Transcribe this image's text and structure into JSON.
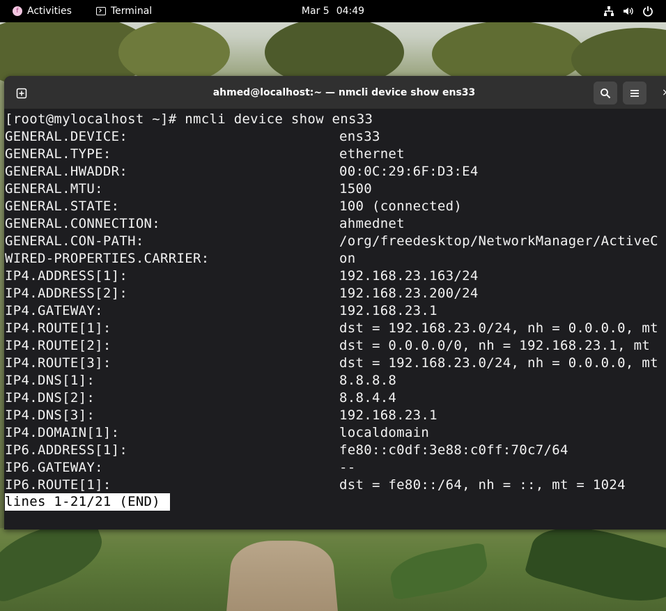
{
  "topbar": {
    "activities_label": "Activities",
    "app_label": "Terminal",
    "date": "Mar 5",
    "time": "04:49",
    "icons": [
      "network-icon",
      "volume-icon",
      "power-icon"
    ]
  },
  "window": {
    "title": "ahmed@localhost:~ — nmcli device show ens33",
    "buttons": [
      "new-tab-icon",
      "search-icon",
      "menu-icon"
    ]
  },
  "terminal": {
    "prompt": "[root@mylocalhost ~]# nmcli device show ens33",
    "rows": [
      {
        "key": "GENERAL.DEVICE:",
        "value": "ens33"
      },
      {
        "key": "GENERAL.TYPE:",
        "value": "ethernet"
      },
      {
        "key": "GENERAL.HWADDR:",
        "value": "00:0C:29:6F:D3:E4"
      },
      {
        "key": "GENERAL.MTU:",
        "value": "1500"
      },
      {
        "key": "GENERAL.STATE:",
        "value": "100 (connected)"
      },
      {
        "key": "GENERAL.CONNECTION:",
        "value": "ahmednet"
      },
      {
        "key": "GENERAL.CON-PATH:",
        "value": "/org/freedesktop/NetworkManager/ActiveC"
      },
      {
        "key": "WIRED-PROPERTIES.CARRIER:",
        "value": "on"
      },
      {
        "key": "IP4.ADDRESS[1]:",
        "value": "192.168.23.163/24"
      },
      {
        "key": "IP4.ADDRESS[2]:",
        "value": "192.168.23.200/24"
      },
      {
        "key": "IP4.GATEWAY:",
        "value": "192.168.23.1"
      },
      {
        "key": "IP4.ROUTE[1]:",
        "value": "dst = 192.168.23.0/24, nh = 0.0.0.0, mt"
      },
      {
        "key": "IP4.ROUTE[2]:",
        "value": "dst = 0.0.0.0/0, nh = 192.168.23.1, mt"
      },
      {
        "key": "IP4.ROUTE[3]:",
        "value": "dst = 192.168.23.0/24, nh = 0.0.0.0, mt"
      },
      {
        "key": "IP4.DNS[1]:",
        "value": "8.8.8.8"
      },
      {
        "key": "IP4.DNS[2]:",
        "value": "8.8.4.4"
      },
      {
        "key": "IP4.DNS[3]:",
        "value": "192.168.23.1"
      },
      {
        "key": "IP4.DOMAIN[1]:",
        "value": "localdomain"
      },
      {
        "key": "IP6.ADDRESS[1]:",
        "value": "fe80::c0df:3e88:c0ff:70c7/64"
      },
      {
        "key": "IP6.GATEWAY:",
        "value": "--"
      },
      {
        "key": "IP6.ROUTE[1]:",
        "value": "dst = fe80::/64, nh = ::, mt = 1024"
      }
    ],
    "pager_status": "lines 1-21/21 (END)"
  },
  "colors": {
    "topbar_bg": "#000000",
    "headerbar_bg": "#303030",
    "terminal_bg": "#1d1d20",
    "terminal_fg": "#f2f2f2",
    "pager_bg": "#ffffff"
  }
}
